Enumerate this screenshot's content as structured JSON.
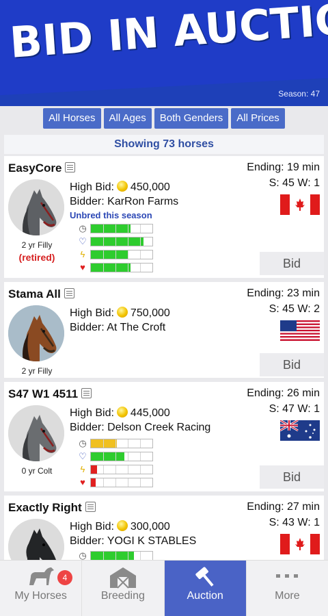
{
  "banner": {
    "title": "BID IN AUCTION",
    "season": "Season: 47"
  },
  "filters": [
    {
      "label": "All Horses"
    },
    {
      "label": "All Ages"
    },
    {
      "label": "Both Genders"
    },
    {
      "label": "All Prices"
    }
  ],
  "count_text": "Showing 73 horses",
  "horses": [
    {
      "name": "EasyCore",
      "age": "2 yr Filly",
      "retired": "(retired)",
      "high_bid": "High Bid:",
      "bid_amount": "450,000",
      "bidder": "Bidder: KarRon Farms",
      "note": "Unbred this season",
      "ending": "Ending: 19 min",
      "season_week": "S: 45 W: 1",
      "flag": "canada",
      "bid_label": "Bid",
      "stats": [
        0.64,
        0.86,
        0.6,
        0.64
      ]
    },
    {
      "name": "Stama All",
      "age": "2 yr Filly",
      "high_bid": "High Bid:",
      "bid_amount": "750,000",
      "bidder": "Bidder: At The Croft",
      "ending": "Ending: 23 min",
      "season_week": "S: 45 W: 2",
      "flag": "usa",
      "bid_label": "Bid"
    },
    {
      "name": "S47 W1 4511",
      "age": "0 yr Colt",
      "high_bid": "High Bid:",
      "bid_amount": "445,000",
      "bidder": "Bidder: Delson Creek Racing",
      "ending": "Ending: 26 min",
      "season_week": "S: 47 W: 1",
      "flag": "australia",
      "bid_label": "Bid",
      "stats": [
        0.42,
        0.54,
        0.1,
        0.08
      ]
    },
    {
      "name": "Exactly Right",
      "high_bid": "High Bid:",
      "bid_amount": "300,000",
      "bidder": "Bidder: YOGI K STABLES",
      "ending": "Ending: 27 min",
      "season_week": "S: 43 W: 1",
      "flag": "canada",
      "stats": [
        0.7
      ]
    }
  ],
  "stat_icons": [
    "speed-icon",
    "heart-rate-icon",
    "lightning-icon",
    "heart-icon"
  ],
  "colors": {
    "accent": "#4a63c6",
    "stat_green": "#2ecc2e",
    "stat_yellow": "#f0c020",
    "stat_red": "#e02020",
    "banner": "#1f3cc7"
  },
  "tabs": [
    {
      "label": "My Horses",
      "badge": "4"
    },
    {
      "label": "Breeding"
    },
    {
      "label": "Auction"
    },
    {
      "label": "More"
    }
  ]
}
